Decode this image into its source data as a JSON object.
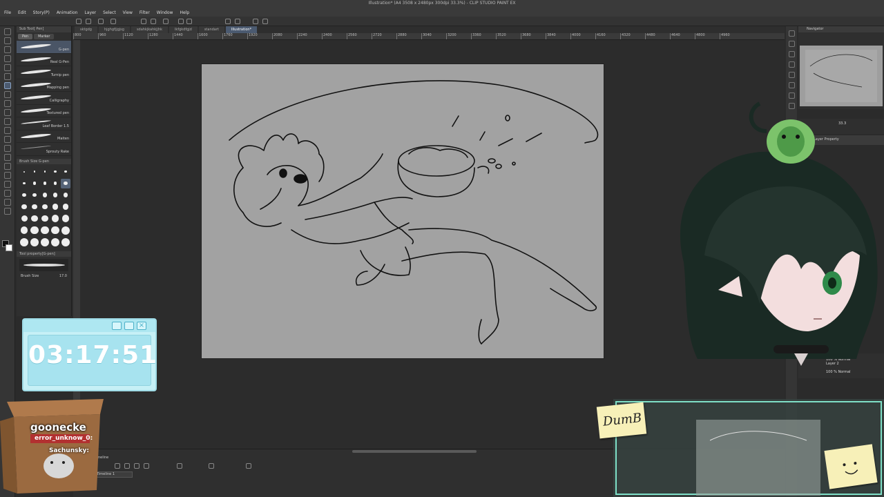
{
  "window": {
    "title": "Illustration* (A4 3508 x 2480px 300dpi 33.3%) - CLIP STUDIO PAINT EX"
  },
  "menu": [
    "File",
    "Edit",
    "Story(P)",
    "Animation",
    "Layer",
    "Select",
    "View",
    "Filter",
    "Window",
    "Help"
  ],
  "doc_tabs": [
    {
      "label": "sktgdg"
    },
    {
      "label": "hjghgfjjgjsg"
    },
    {
      "label": "sdahkjkahkjjhk"
    },
    {
      "label": "lkfgkdfgjd"
    },
    {
      "label": "standart"
    },
    {
      "label": "Illustration*",
      "active": true
    }
  ],
  "ruler_ticks": [
    "800",
    "960",
    "1120",
    "1280",
    "1440",
    "1600",
    "1760",
    "1920",
    "2080",
    "2240",
    "2400",
    "2560",
    "2720",
    "2880",
    "3040",
    "3200",
    "3360",
    "3520",
    "3680",
    "3840",
    "4000",
    "4160",
    "4320",
    "4480",
    "4640",
    "4800",
    "4960"
  ],
  "sub_tool": {
    "header": "Sub Tool[ Pen]",
    "tabs": [
      "Pen",
      "Marker"
    ],
    "brushes": [
      {
        "name": "G-pen",
        "selected": true
      },
      {
        "name": "Real G-Pen"
      },
      {
        "name": "Turnip pen"
      },
      {
        "name": "Mapping pen"
      },
      {
        "name": "Calligraphy"
      },
      {
        "name": "Textured pen"
      },
      {
        "name": "Leaf Border 1.5"
      },
      {
        "name": "Maiten"
      },
      {
        "name": "Sprouty Rake"
      }
    ]
  },
  "brush_size": {
    "header": "Brush Size G-pen",
    "sizes": [
      "3",
      "4",
      "5",
      "6",
      "7",
      "8",
      "10",
      "12",
      "15",
      "17",
      "20",
      "25",
      "30",
      "40",
      "50",
      "60",
      "70",
      "80",
      "100",
      "120",
      "150",
      "170",
      "200",
      "250",
      "300",
      "400",
      "500",
      "600",
      "700",
      "800",
      "1000",
      "1200",
      "1500",
      "1700",
      "2000"
    ],
    "selected": "17"
  },
  "tool_property": {
    "header": "Tool property[G-pen]",
    "preview_label": "G-pen",
    "brush_size_label": "Brush Size",
    "brush_size_value": "17.0"
  },
  "navigator": {
    "header": "Navigator",
    "zoom": "33.3",
    "layer_property": "Layer Property"
  },
  "layers": [
    {
      "opacity": "100 %",
      "blend": "Normal",
      "name": "Layer 2"
    },
    {
      "opacity": "100 %",
      "blend": "Normal",
      "name": ""
    }
  ],
  "timeline": {
    "header": "Timeline",
    "dropdown": "Timeline 1"
  },
  "timer": {
    "time": "03:17:51"
  },
  "chat": {
    "user": "goonecke",
    "highlight": "error_unknow_0:",
    "user2": "Sachunsky:"
  },
  "stickies": {
    "dumb": "DumB"
  },
  "colors": {
    "canvas_bg": "#a2a2a2",
    "timer_bg": "#c6f0f6",
    "accent": "#4b5a70",
    "chat_red": "#b23030"
  }
}
